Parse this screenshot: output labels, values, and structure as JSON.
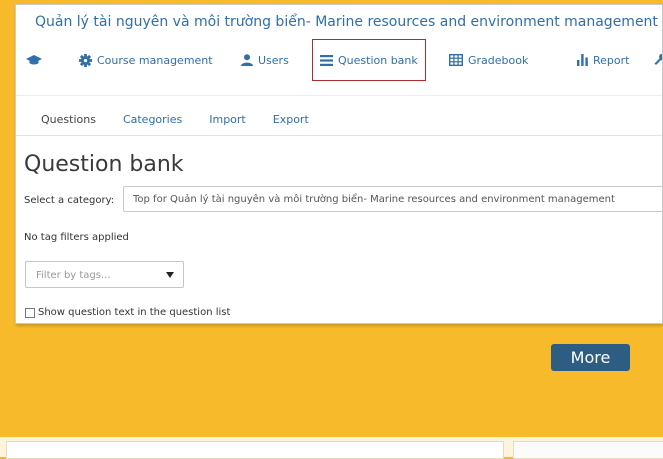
{
  "course_title": "Quản lý tài nguyên và môi trường biển- Marine resources and environment management",
  "nav": {
    "course_management": "Course management",
    "users": "Users",
    "question_bank": "Question bank",
    "gradebook": "Gradebook",
    "report": "Report"
  },
  "tabs": [
    "Questions",
    "Categories",
    "Import",
    "Export"
  ],
  "page_title": "Question bank",
  "category": {
    "label": "Select a category:",
    "value": "Top for Quản lý tài nguyên và môi trường biển- Marine resources and environment management"
  },
  "tag_note": "No tag filters applied",
  "tag_filter_placeholder": "Filter by tags...",
  "show_question_text": "Show question text in the question list",
  "more_button": "More",
  "colors": {
    "accent": "#2f6fab",
    "background": "#f6ba2a",
    "button": "#2e5d83",
    "active_border": "#b0292b"
  },
  "icons": [
    "graduation-cap-icon",
    "gear-icon",
    "user-icon",
    "list-icon",
    "grid-icon",
    "bar-chart-icon",
    "wrench-icon"
  ]
}
